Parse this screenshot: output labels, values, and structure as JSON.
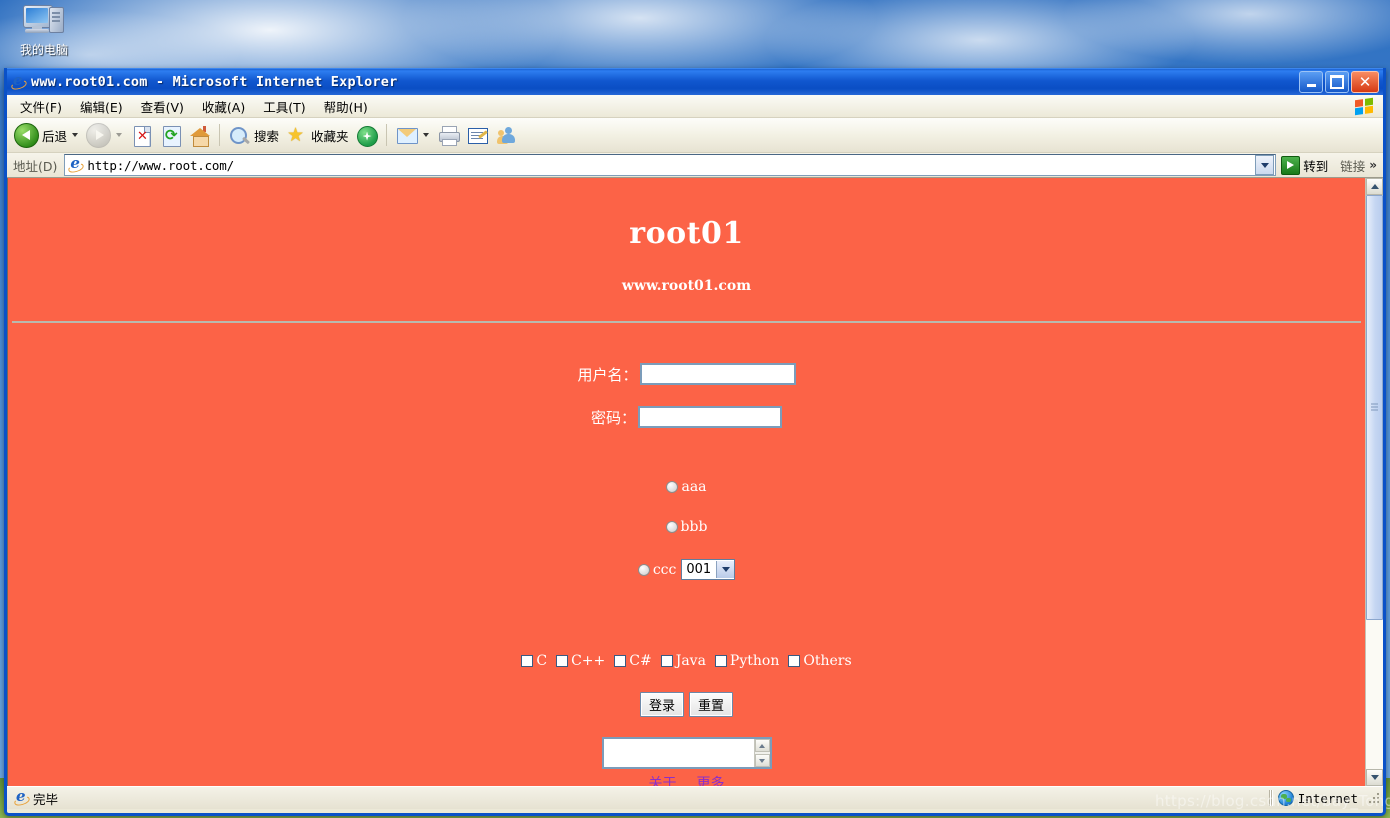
{
  "desktop": {
    "icons": [
      {
        "label": "我的电脑",
        "icon": "my-computer-icon"
      }
    ]
  },
  "window": {
    "title": "www.root01.com - Microsoft Internet Explorer",
    "controls": {
      "minimize": "minimize-button",
      "maximize": "maximize-button",
      "close": "close-button"
    }
  },
  "menubar": {
    "items": [
      {
        "label": "文件(F)"
      },
      {
        "label": "编辑(E)"
      },
      {
        "label": "查看(V)"
      },
      {
        "label": "收藏(A)"
      },
      {
        "label": "工具(T)"
      },
      {
        "label": "帮助(H)"
      }
    ]
  },
  "toolbar": {
    "back_label": "后退",
    "search_label": "搜索",
    "favorites_label": "收藏夹"
  },
  "addressbar": {
    "label": "地址(D)",
    "url": "http://www.root.com/",
    "go_label": "转到",
    "links_label": "链接",
    "overflow": "»"
  },
  "page": {
    "title": "root01",
    "subtitle": "www.root01.com",
    "background_color": "#fc6347",
    "fields": [
      {
        "label": "用户名：",
        "value": "",
        "name": "username"
      },
      {
        "label": "密码：",
        "value": "",
        "name": "password"
      }
    ],
    "radios": [
      {
        "label": "aaa",
        "checked": false
      },
      {
        "label": "bbb",
        "checked": false
      },
      {
        "label": "ccc",
        "checked": false
      }
    ],
    "select": {
      "value": "001",
      "options": [
        "001"
      ]
    },
    "checkboxes": [
      {
        "label": "C",
        "checked": false
      },
      {
        "label": "C++",
        "checked": false
      },
      {
        "label": "C#",
        "checked": false
      },
      {
        "label": "Java",
        "checked": false
      },
      {
        "label": "Python",
        "checked": false
      },
      {
        "label": "Others",
        "checked": false
      }
    ],
    "buttons": [
      {
        "label": "登录",
        "name": "login"
      },
      {
        "label": "重置",
        "name": "reset"
      }
    ],
    "textarea": {
      "value": ""
    },
    "links": [
      {
        "label": "关于",
        "color": "#8b2fc9"
      },
      {
        "label": "更多",
        "color": "#8b2fc9"
      }
    ]
  },
  "statusbar": {
    "status": "完毕",
    "zone": "Internet"
  },
  "watermark": "https://blog.csdn.net/bay_Tong"
}
